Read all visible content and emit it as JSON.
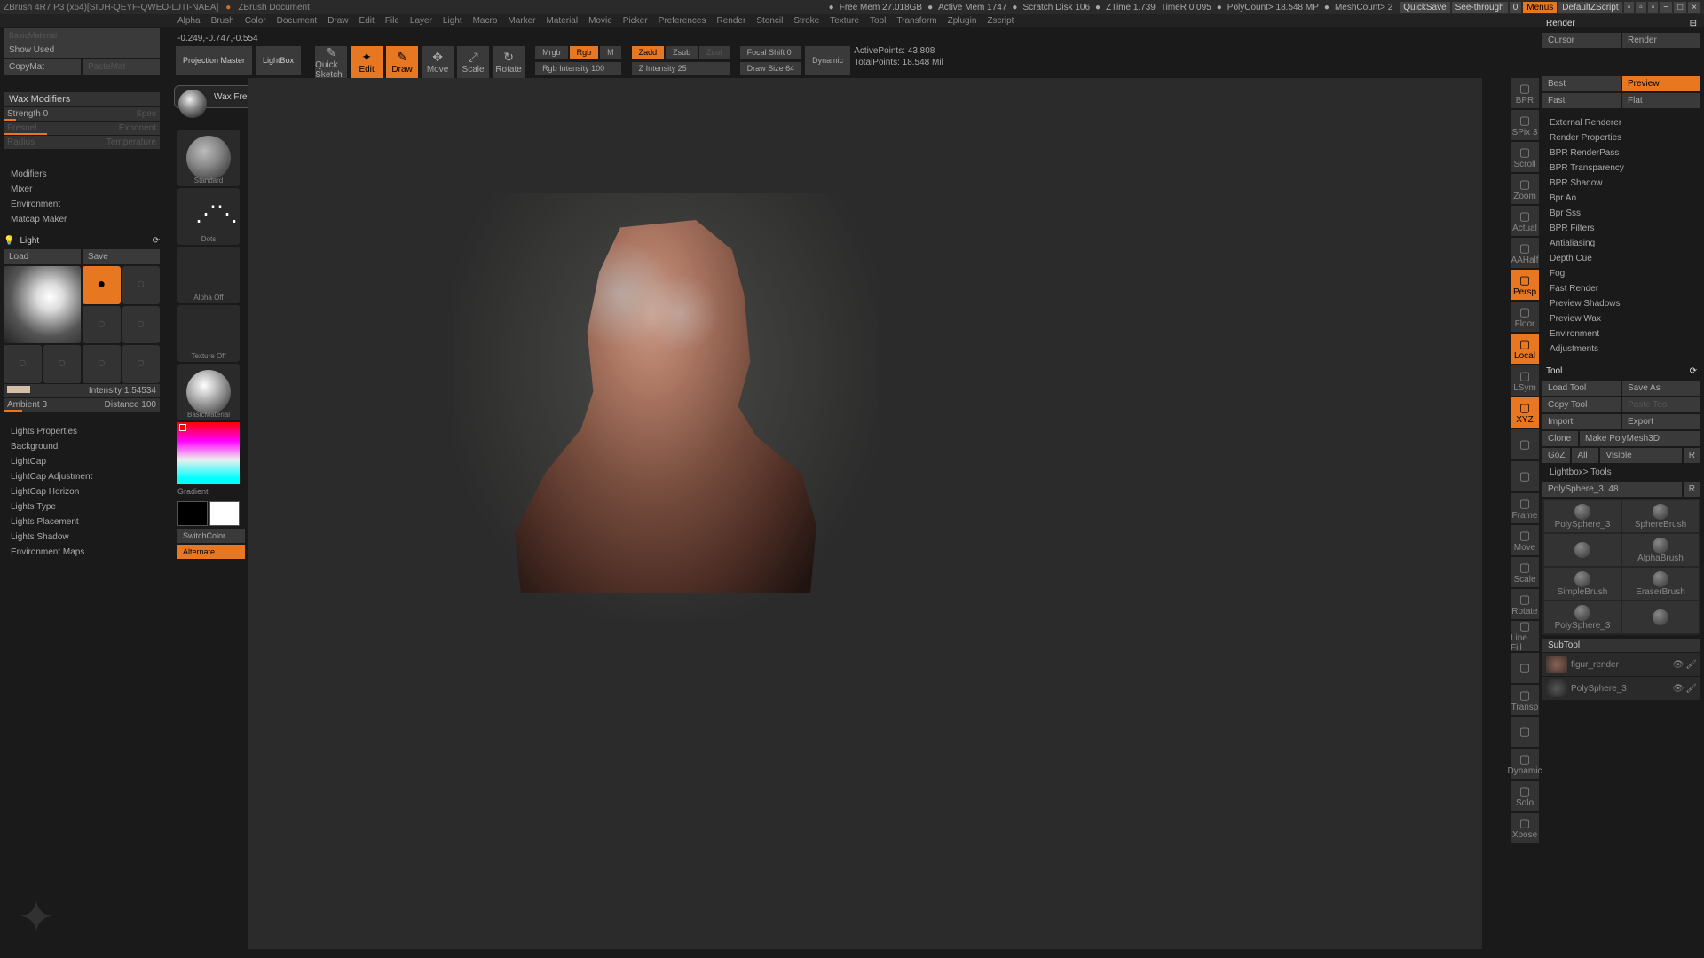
{
  "title_bar": {
    "app": "ZBrush 4R7 P3 (x64)[SIUH-QEYF-QWEO-LJTI-NAEA]",
    "doc": "ZBrush Document",
    "stats": [
      "Free Mem 27.018GB",
      "Active Mem 1747",
      "Scratch Disk 106",
      "ZTime 1.739",
      "TimeR 0.095",
      "PolyCount> 18.548 MP",
      "MeshCount> 2"
    ],
    "quicksave": "QuickSave",
    "seethrough": "See-through",
    "seethrough_val": "0",
    "menus": "Menus",
    "script": "DefaultZScript"
  },
  "menu": [
    "Alpha",
    "Brush",
    "Color",
    "Document",
    "Draw",
    "Edit",
    "File",
    "Layer",
    "Light",
    "Macro",
    "Marker",
    "Material",
    "Movie",
    "Picker",
    "Preferences",
    "Render",
    "Stencil",
    "Stroke",
    "Texture",
    "Tool",
    "Transform",
    "Zplugin",
    "Zscript"
  ],
  "coord": "-0.249,-0.747,-0.554",
  "toolbar": {
    "projection": "Projection Master",
    "lightbox": "LightBox",
    "quicksketch": "Quick Sketch",
    "edit": "Edit",
    "draw": "Draw",
    "move": "Move",
    "scale": "Scale",
    "rotate": "Rotate",
    "mrgb": "Mrgb",
    "rgb": "Rgb",
    "m": "M",
    "rgb_intensity": "Rgb Intensity 100",
    "zadd": "Zadd",
    "zsub": "Zsub",
    "zcut": "Zcut",
    "z_intensity": "Z Intensity 25",
    "focal": "Focal Shift 0",
    "drawsize": "Draw Size 64",
    "dynamic": "Dynamic",
    "activepoints": "ActivePoints: 43,808",
    "totalpoints": "TotalPoints: 18.548 Mil"
  },
  "tooltip": "Wax Fresnel Blending Strength",
  "left": {
    "basicmaterial": "BasicMaterial",
    "showused": "Show Used",
    "copymat": "CopyMat",
    "pastemat": "PasteMat",
    "wax": "Wax Modifiers",
    "strength": "Strength 0",
    "spec": "Spec",
    "fresnel": "Fresnel",
    "exponent": "Exponent",
    "radius": "Radius",
    "temperature": "Temperature",
    "modifiers": "Modifiers",
    "mixer": "Mixer",
    "environment": "Environment",
    "matcap": "Matcap Maker",
    "light": "Light",
    "load": "Load",
    "save": "Save",
    "intensity": "Intensity 1.54534",
    "ambient": "Ambient 3",
    "distance": "Distance 100",
    "lights_props": "Lights Properties",
    "background": "Background",
    "lightcap": "LightCap",
    "lightcap_adj": "LightCap Adjustment",
    "lightcap_hor": "LightCap Horizon",
    "lights_type": "Lights Type",
    "lights_place": "Lights Placement",
    "lights_shadow": "Lights Shadow",
    "env_maps": "Environment Maps"
  },
  "mat": {
    "standard": "Standard",
    "dots": "Dots",
    "alpha_off": "Alpha Off",
    "texture_off": "Texture Off",
    "basic": "BasicMaterial",
    "gradient": "Gradient",
    "switchcolor": "SwitchColor",
    "alternate": "Alternate"
  },
  "right_tools": [
    "BPR",
    "SPix 3",
    "Scroll",
    "Zoom",
    "Actual",
    "AAHalf",
    "Persp",
    "Floor",
    "Local",
    "LSym",
    "XYZ",
    "",
    "",
    "Frame",
    "Move",
    "Scale",
    "Rotate",
    "Line Fill",
    "",
    "Transp",
    "",
    "Dynamic",
    "Solo",
    "Xpose"
  ],
  "render": {
    "header": "Render",
    "cursor": "Cursor",
    "render": "Render",
    "best": "Best",
    "preview": "Preview",
    "fast": "Fast",
    "flat": "Flat",
    "items": [
      "External Renderer",
      "Render Properties",
      "BPR RenderPass",
      "BPR Transparency",
      "BPR Shadow",
      "Bpr Ao",
      "Bpr Sss",
      "BPR Filters",
      "Antialiasing",
      "Depth Cue",
      "Fog",
      "Fast Render",
      "Preview Shadows",
      "Preview Wax",
      "Environment",
      "Adjustments"
    ]
  },
  "tool": {
    "header": "Tool",
    "loadtool": "Load Tool",
    "saveas": "Save As",
    "copytool": "Copy Tool",
    "pastetool": "Paste Tool",
    "import": "Import",
    "export": "Export",
    "clone": "Clone",
    "makepoly": "Make PolyMesh3D",
    "goz": "GoZ",
    "all": "All",
    "visible": "Visible",
    "r": "R",
    "lightbox_tools": "Lightbox> Tools",
    "polysphere": "PolySphere_3. 48",
    "thumbs": [
      "PolySphere_3",
      "SphereBrush",
      "",
      "AlphaBrush",
      "SimpleBrush",
      "EraserBrush",
      "PolySphere_3",
      ""
    ],
    "subtool": "SubTool",
    "subtools": [
      "figur_render",
      "PolySphere_3"
    ]
  }
}
